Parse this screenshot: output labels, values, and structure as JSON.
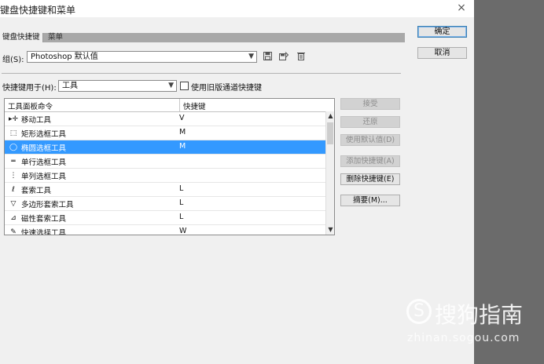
{
  "window": {
    "title": "键盘快捷键和菜单",
    "close_icon": "×"
  },
  "tabs": [
    {
      "label": "键盘快捷键"
    },
    {
      "label": "菜单"
    }
  ],
  "group": {
    "label": "组(S):",
    "value": "Photoshop 默认值",
    "icons": [
      "save-icon",
      "save-as-icon",
      "delete-icon"
    ]
  },
  "shortcuts_for": {
    "label": "快捷键用于(H):",
    "value": "工具",
    "legacy_checkbox_label": "使用旧版通道快捷键",
    "legacy_checked": false
  },
  "table": {
    "col_command": "工具面板命令",
    "col_shortcut": "快捷键",
    "rows": [
      {
        "icon": "▸✛",
        "name": "移动工具",
        "key": "V",
        "selected": false
      },
      {
        "icon": "⬚",
        "name": "矩形选框工具",
        "key": "M",
        "selected": false
      },
      {
        "icon": "◯",
        "name": "椭圆选框工具",
        "key": "M",
        "selected": true
      },
      {
        "icon": "═",
        "name": "单行选框工具",
        "key": "",
        "selected": false
      },
      {
        "icon": "⋮",
        "name": "单列选框工具",
        "key": "",
        "selected": false
      },
      {
        "icon": "ℓ",
        "name": "套索工具",
        "key": "L",
        "selected": false
      },
      {
        "icon": "▽",
        "name": "多边形套索工具",
        "key": "L",
        "selected": false
      },
      {
        "icon": "⊿",
        "name": "磁性套索工具",
        "key": "L",
        "selected": false
      },
      {
        "icon": "✎",
        "name": "快速选择工具",
        "key": "W",
        "selected": false
      }
    ]
  },
  "side_buttons": {
    "accept": "接受",
    "undo": "还原",
    "use_default": "使用默认值(D)",
    "add_shortcut": "添加快捷键(A)",
    "delete_shortcut": "删除快捷键(E)",
    "summary": "摘要(M)..."
  },
  "dialog_buttons": {
    "ok": "确定",
    "cancel": "取消"
  },
  "watermark": {
    "brand": "搜狗指南",
    "url": "zhinan.sogou.com",
    "logo_glyph": "S"
  }
}
